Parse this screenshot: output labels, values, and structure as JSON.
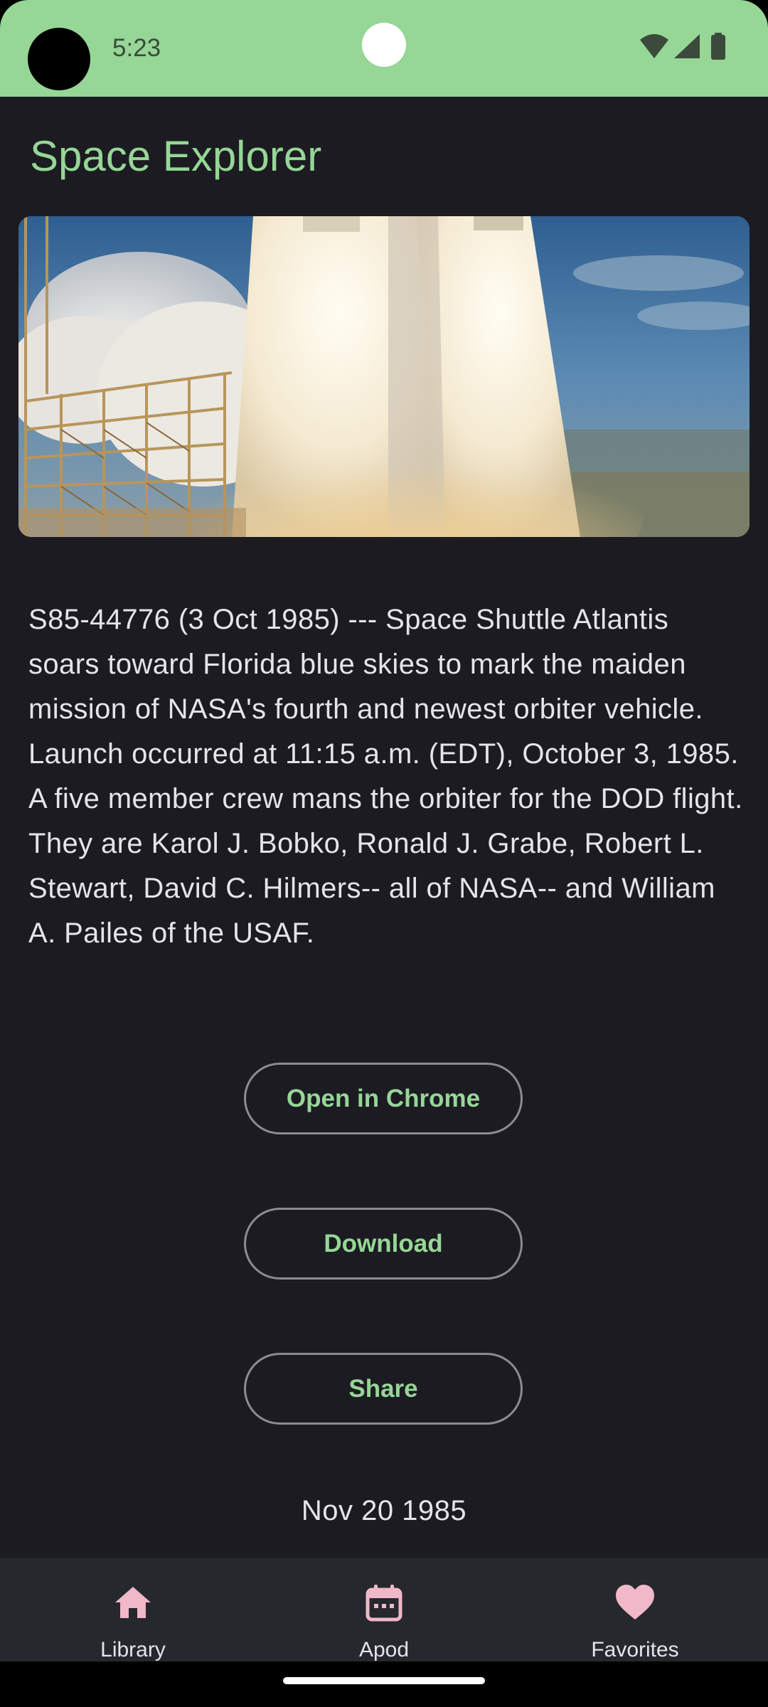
{
  "status_bar": {
    "time": "5:23",
    "icons": [
      "wifi-icon",
      "cellular-signal-icon",
      "battery-icon"
    ],
    "background_color": "#96d696"
  },
  "app": {
    "title": "Space Explorer",
    "accent_color": "#96d696"
  },
  "photo": {
    "subject": "Space Shuttle Atlantis launch exhaust plumes"
  },
  "description": "S85-44776 (3 Oct 1985) --- Space Shuttle Atlantis soars toward Florida blue skies to mark the maiden mission of NASA's fourth and newest orbiter vehicle.  Launch occurred at 11:15 a.m. (EDT), October 3, 1985.  A five member crew mans the orbiter for the DOD flight.  They are Karol J. Bobko, Ronald J. Grabe, Robert L. Stewart, David C. Hilmers-- all of NASA-- and William A. Pailes of the USAF.",
  "buttons": {
    "open_in_chrome": "Open in Chrome",
    "download": "Download",
    "share": "Share"
  },
  "date": "Nov 20 1985",
  "bottom_nav": {
    "items": [
      {
        "label": "Library",
        "icon": "home-icon"
      },
      {
        "label": "Apod",
        "icon": "calendar-icon"
      },
      {
        "label": "Favorites",
        "icon": "heart-icon"
      }
    ],
    "icon_color": "#f0b8c8"
  }
}
